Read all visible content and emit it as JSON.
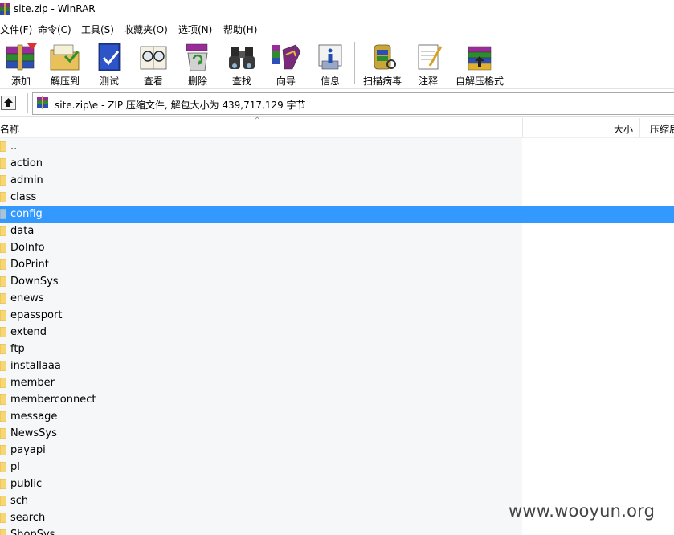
{
  "window": {
    "title": "site.zip - WinRAR"
  },
  "menu": [
    {
      "label": "文件(F)"
    },
    {
      "label": "命令(C)"
    },
    {
      "label": "工具(S)"
    },
    {
      "label": "收藏夹(O)"
    },
    {
      "label": "选项(N)"
    },
    {
      "label": "帮助(H)"
    }
  ],
  "toolbar": [
    {
      "label": "添加",
      "icon": "add-books-icon"
    },
    {
      "label": "解压到",
      "icon": "extract-folder-icon"
    },
    {
      "label": "测试",
      "icon": "test-book-icon"
    },
    {
      "label": "查看",
      "icon": "view-glasses-icon"
    },
    {
      "label": "删除",
      "icon": "delete-recycle-icon"
    },
    {
      "label": "查找",
      "icon": "find-binoculars-icon"
    },
    {
      "label": "向导",
      "icon": "wizard-icon"
    },
    {
      "label": "信息",
      "icon": "info-icon"
    },
    {
      "label": "扫描病毒",
      "icon": "virus-scan-icon"
    },
    {
      "label": "注释",
      "icon": "comment-pen-icon"
    },
    {
      "label": "自解压格式",
      "icon": "sfx-archive-icon"
    }
  ],
  "address": {
    "text": "site.zip\\e - ZIP 压缩文件, 解包大小为 439,717,129 字节"
  },
  "columns": {
    "name": "名称",
    "size": "大小",
    "packed": "压缩后"
  },
  "files": [
    {
      "name": ".."
    },
    {
      "name": "action"
    },
    {
      "name": "admin"
    },
    {
      "name": "class"
    },
    {
      "name": "config",
      "selected": true
    },
    {
      "name": "data"
    },
    {
      "name": "DoInfo"
    },
    {
      "name": "DoPrint"
    },
    {
      "name": "DownSys"
    },
    {
      "name": "enews"
    },
    {
      "name": "epassport"
    },
    {
      "name": "extend"
    },
    {
      "name": "ftp"
    },
    {
      "name": "installaaa"
    },
    {
      "name": "member"
    },
    {
      "name": "memberconnect"
    },
    {
      "name": "message"
    },
    {
      "name": "NewsSys"
    },
    {
      "name": "payapi"
    },
    {
      "name": "pl"
    },
    {
      "name": "public"
    },
    {
      "name": "sch"
    },
    {
      "name": "search"
    },
    {
      "name": "ShopSys"
    }
  ],
  "watermark": "www.wooyun.org",
  "colors": {
    "selection": "#3399ff",
    "folder": "#f7d774"
  }
}
